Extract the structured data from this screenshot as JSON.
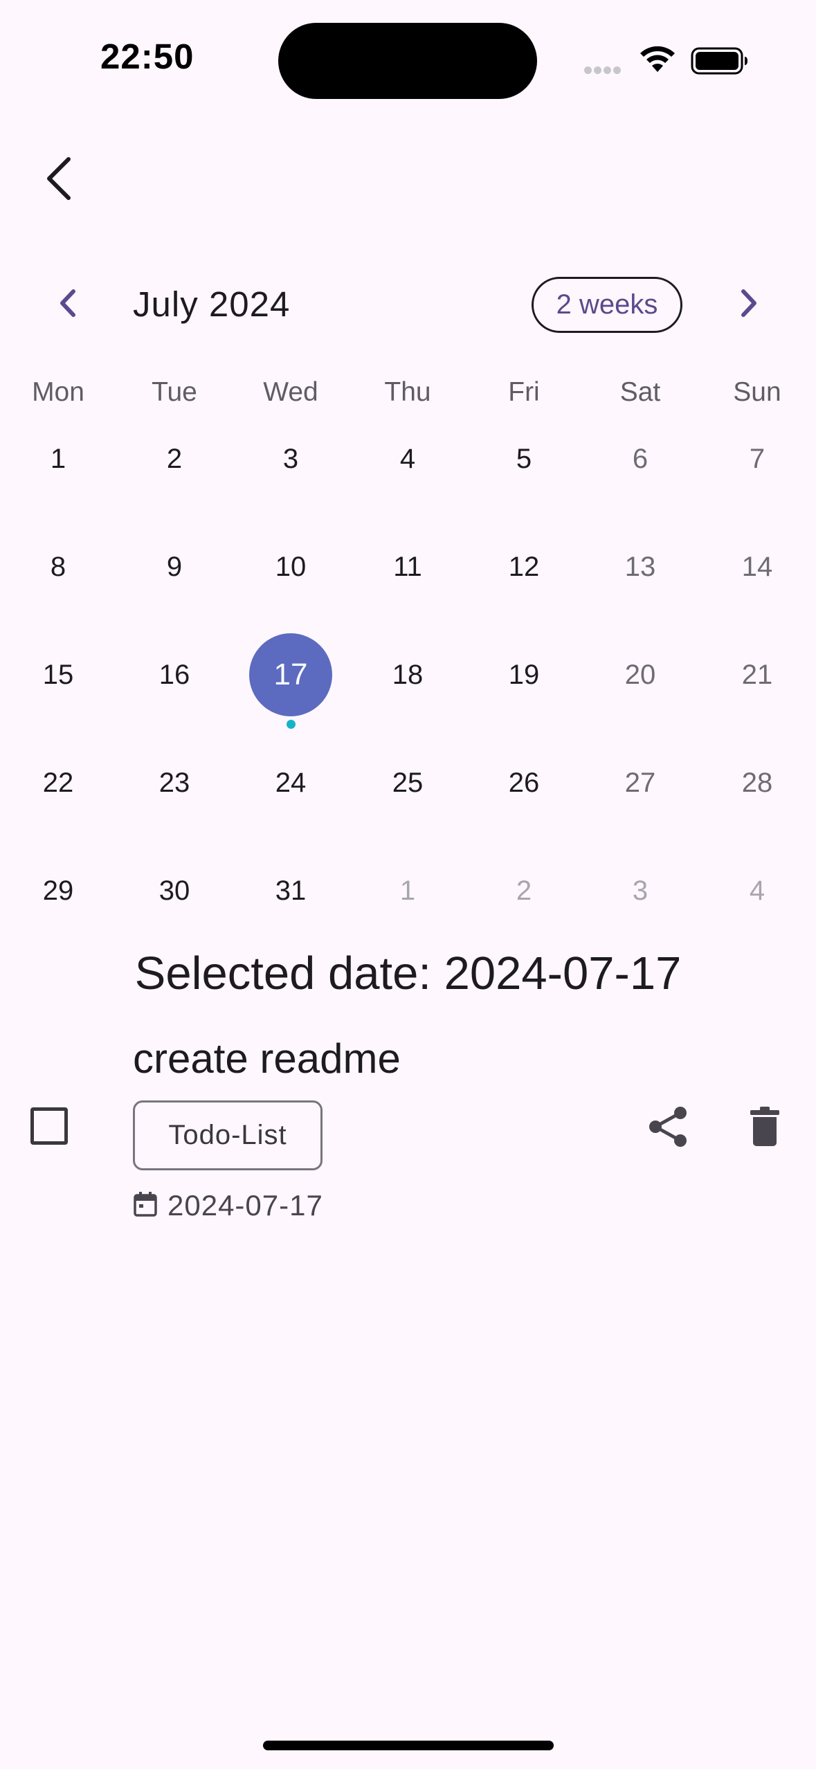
{
  "status_bar": {
    "time": "22:50"
  },
  "calendar": {
    "month_title": "July 2024",
    "format_button_label": "2 weeks",
    "weekdays": [
      "Mon",
      "Tue",
      "Wed",
      "Thu",
      "Fri",
      "Sat",
      "Sun"
    ],
    "weeks": [
      [
        "1",
        "2",
        "3",
        "4",
        "5",
        "6",
        "7"
      ],
      [
        "8",
        "9",
        "10",
        "11",
        "12",
        "13",
        "14"
      ],
      [
        "15",
        "16",
        "17",
        "18",
        "19",
        "20",
        "21"
      ],
      [
        "22",
        "23",
        "24",
        "25",
        "26",
        "27",
        "28"
      ],
      [
        "29",
        "30",
        "31",
        "1",
        "2",
        "3",
        "4"
      ]
    ],
    "selected_day": "17",
    "event_marker_day": "17"
  },
  "selected_date_text": "Selected date: 2024-07-17",
  "task": {
    "title": "create readme",
    "tag": "Todo-List",
    "date": "2024-07-17",
    "checked": false
  },
  "colors": {
    "background": "#FEF7FE",
    "selected_day": "#5C6BC0",
    "event_marker": "#14B4C8",
    "accent": "#5B4A8C"
  },
  "icons": [
    "back-arrow-icon",
    "chevron-left-icon",
    "chevron-right-icon",
    "calendar-icon",
    "share-icon",
    "trash-icon",
    "wifi-icon",
    "battery-icon"
  ]
}
